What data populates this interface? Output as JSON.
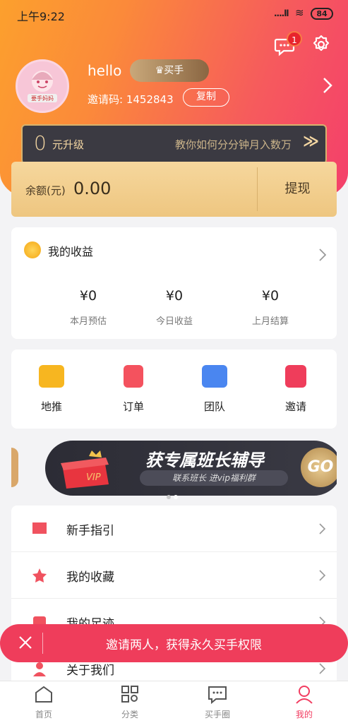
{
  "status_bar": {
    "time": "上午9:22",
    "signal": "....ll",
    "wifi": "≋",
    "battery": "84"
  },
  "header": {
    "message_badge": "1",
    "username": "hello",
    "level_badge": "买手",
    "invite_code_label": "邀请码: 1452843",
    "copy_label": "复制"
  },
  "upgrade": {
    "number": "0",
    "text": "元升级",
    "hint": "教你如何分分钟月入数万",
    "arrows": "≫"
  },
  "balance": {
    "label": "余额(元)",
    "value": "0.00",
    "withdraw_label": "提现"
  },
  "earnings": {
    "title": "我的收益",
    "stats": [
      {
        "value": "¥0",
        "label": "本月预估"
      },
      {
        "value": "¥0",
        "label": "今日收益"
      },
      {
        "value": "¥0",
        "label": "上月结算"
      }
    ]
  },
  "menu": [
    {
      "label": "地推",
      "color": "#f7b620"
    },
    {
      "label": "订单",
      "color": "#f4525e"
    },
    {
      "label": "团队",
      "color": "#4a86f0"
    },
    {
      "label": "邀请",
      "color": "#ef3d5b"
    }
  ],
  "banner": {
    "title": "获专属班长辅导",
    "subtitle": "联系班长  进vip福利群",
    "go": "GO",
    "gift_text": "VIP"
  },
  "list": [
    {
      "label": "新手指引",
      "icon": "flag-icon",
      "color": "#f0525f"
    },
    {
      "label": "我的收藏",
      "icon": "star-icon",
      "color": "#f0525f"
    },
    {
      "label": "我的足迹",
      "icon": "footprint-icon",
      "color": "#f0525f"
    },
    {
      "label": "关于我们",
      "icon": "user-icon",
      "color": "#f0525f"
    }
  ],
  "toast": {
    "message": "邀请两人，获得永久买手权限"
  },
  "tabs": [
    {
      "label": "首页",
      "icon": "home-icon"
    },
    {
      "label": "分类",
      "icon": "category-icon"
    },
    {
      "label": "买手圈",
      "icon": "chat-icon"
    },
    {
      "label": "我的",
      "icon": "profile-icon"
    }
  ],
  "colors": {
    "accent": "#f23c60",
    "gold": "#eec680",
    "dark": "#3b3a42"
  }
}
